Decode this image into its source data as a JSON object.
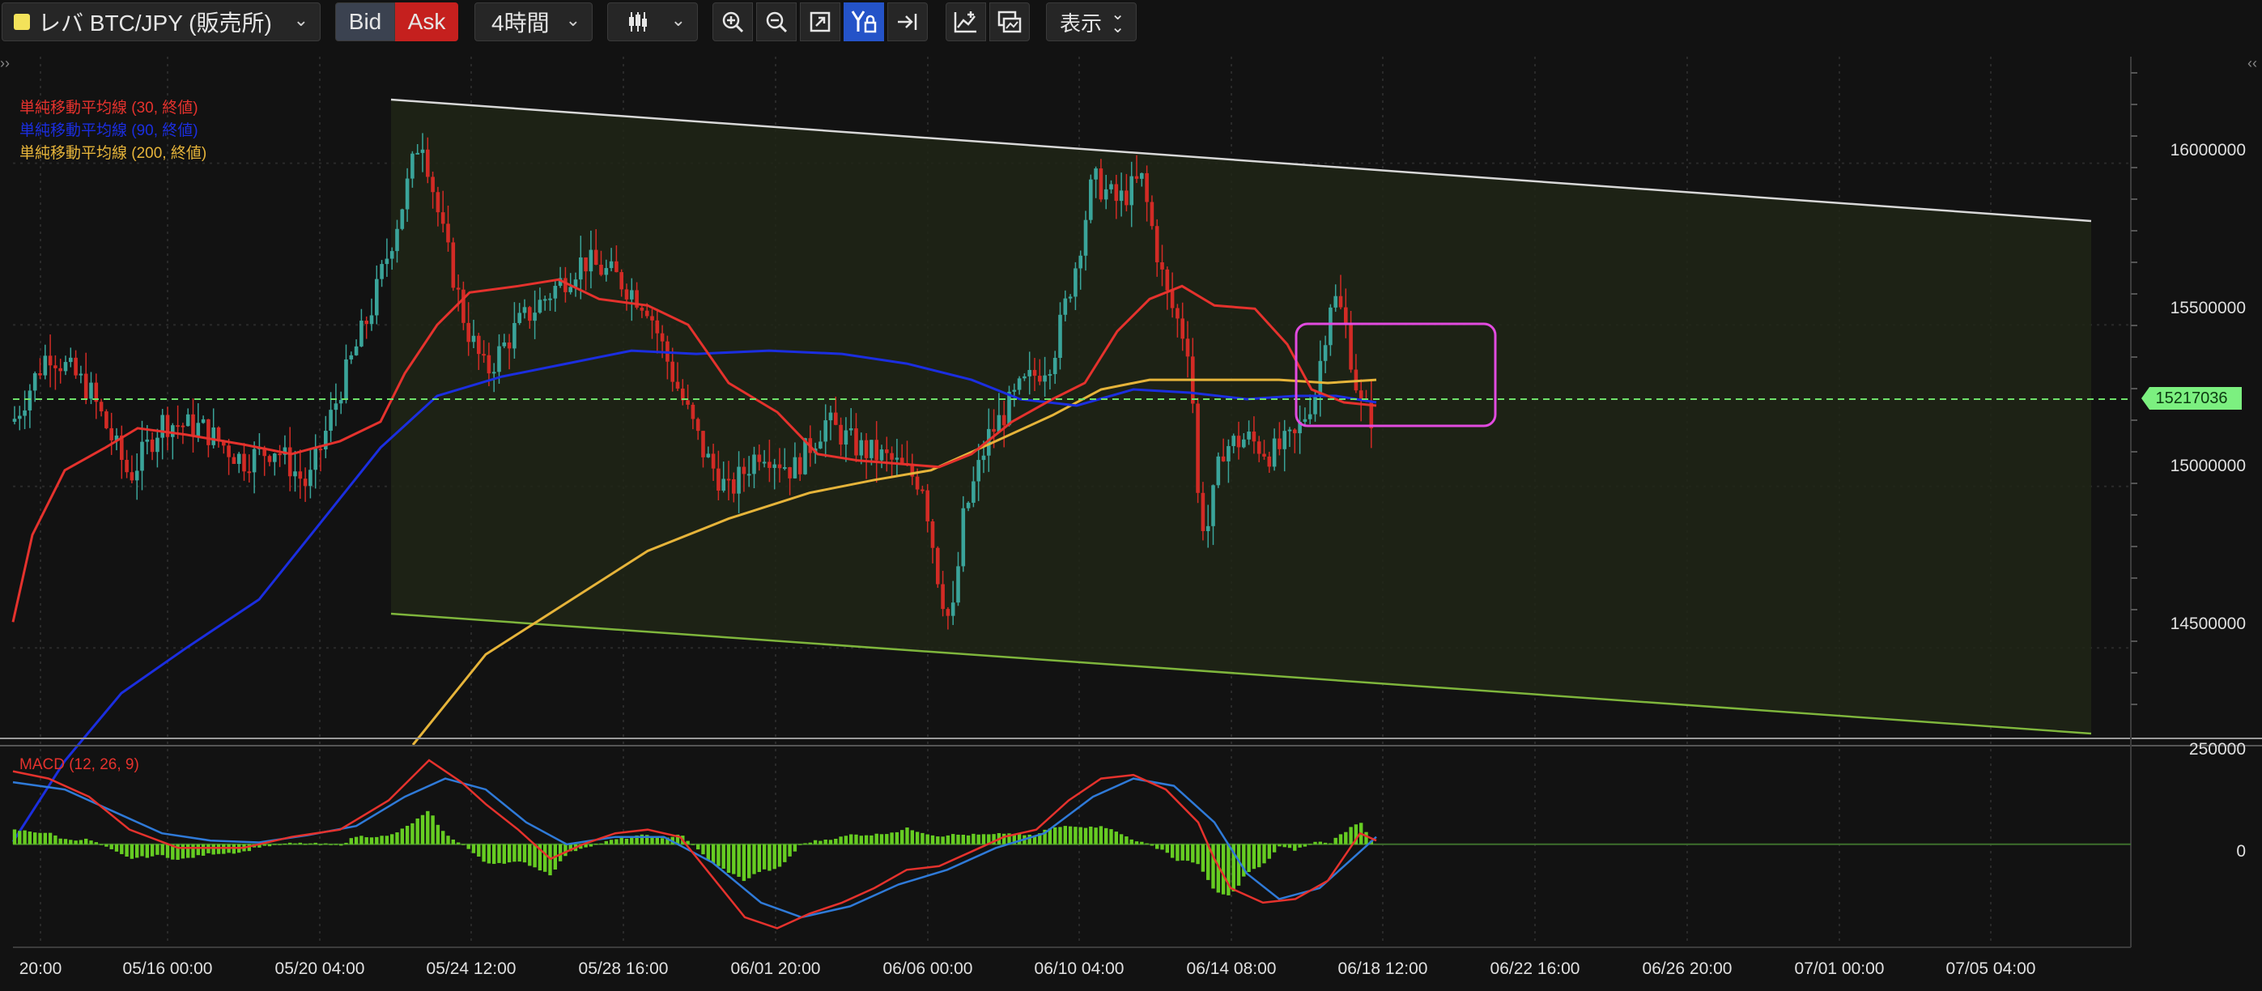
{
  "toolbar": {
    "symbol": "レバ BTC/JPY (販売所)",
    "bid_label": "Bid",
    "ask_label": "Ask",
    "interval": "4時間",
    "display_label": "表示"
  },
  "chart_data": {
    "type": "candlestick",
    "price_panel": {
      "indicators": [
        {
          "name": "単純移動平均線 (30, 終値)",
          "color": "#e5322d"
        },
        {
          "name": "単純移動平均線 (90, 終値)",
          "color": "#1b2ee0"
        },
        {
          "name": "単純移動平均線 (200, 終値)",
          "color": "#e6b43a"
        }
      ],
      "y_ticks": [
        16000000,
        15500000,
        15000000,
        14500000
      ],
      "ylim": [
        14220000,
        16330000
      ],
      "current_price": 15217036
    },
    "macd_panel": {
      "label": "MACD (12, 26, 9)",
      "y_ticks": [
        250000,
        0
      ],
      "ylim": [
        -260000,
        270000
      ],
      "colors": {
        "macd": "#e5322d",
        "signal": "#2f7ad8",
        "histogram": "#66cc22"
      }
    },
    "x_tick_labels": [
      "20:00",
      "05/16 00:00",
      "05/20 04:00",
      "05/24 12:00",
      "05/28 16:00",
      "06/01 20:00",
      "06/06 00:00",
      "06/10 04:00",
      "06/14 08:00",
      "06/18 12:00",
      "06/22 16:00",
      "06/26 20:00",
      "07/01 00:00",
      "07/05 04:00"
    ],
    "colors": {
      "up": "#3aa49a",
      "down": "#d22b25",
      "channel_upper": "#d8d8d8",
      "channel_lower": "#7fb63c",
      "price_line": "#6ee26a",
      "highlight_box": "#e24be0"
    }
  }
}
